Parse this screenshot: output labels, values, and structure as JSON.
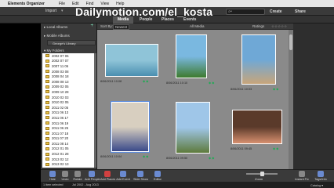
{
  "menubar": {
    "app": "Elements Organizer",
    "items": [
      "File",
      "Edit",
      "Find",
      "View",
      "Help"
    ]
  },
  "topbar": {
    "import": "Import",
    "create": "Create",
    "share": "Share"
  },
  "watermark": "Dailymotion.com/el_kosta",
  "tabs": [
    {
      "label": "Media",
      "active": true
    },
    {
      "label": "People",
      "active": false
    },
    {
      "label": "Places",
      "active": false
    },
    {
      "label": "Events",
      "active": false
    }
  ],
  "sidebar": {
    "local_albums": "Local Albums",
    "mobile_albums": "Mobile Albums",
    "library": "George's Library",
    "my_folders": "My Folders",
    "folders": [
      "2002 07 06",
      "2002 07 07",
      "2007 11 06",
      "2008 03 08",
      "2008 04 18",
      "2008 08 13",
      "2009 02 05",
      "2009 10 28",
      "2010 02 03",
      "2010 02 05",
      "2011 02 05",
      "2011 06 13",
      "2011 06 17",
      "2011 06 19",
      "2011 06 25",
      "2011 07 18",
      "2011 07 20",
      "2011 08 14",
      "2012 01 05",
      "2012 01 28",
      "2013 02 12",
      "2013 02 13"
    ]
  },
  "filterbar": {
    "sort_by": "Sort By:",
    "sort_value": "Newest",
    "view": "All Media",
    "ratings": "Ratings"
  },
  "photos": [
    {
      "date": "8/06/2011 10:08",
      "colors": [
        "#8fc4d8",
        "#4a8fb0"
      ],
      "selected": false
    },
    {
      "date": "8/06/2011 10:10",
      "colors": [
        "#7ab8e0",
        "#3d7a2e"
      ],
      "selected": false
    },
    {
      "date": "8/06/2011 10:03",
      "colors": [
        "#6fa8d6",
        "#c8a57a"
      ],
      "selected": false
    },
    {
      "date": "8/06/2011 10:04",
      "colors": [
        "#d8cfc0",
        "#3a4a8a"
      ],
      "selected": true
    },
    {
      "date": "8/06/2011 09:50",
      "colors": [
        "#9fc6e8",
        "#5e7a3c"
      ],
      "selected": false
    },
    {
      "date": "8/06/2011 09:45",
      "colors": [
        "#5a3a2a",
        "#d89070"
      ],
      "selected": false
    }
  ],
  "bottombar": {
    "buttons": [
      {
        "label": "Hide",
        "color": "#6a8ad0"
      },
      {
        "label": "Undo",
        "color": "#888"
      },
      {
        "label": "Rotate",
        "color": "#888"
      },
      {
        "label": "Add People",
        "color": "#6a8ad0"
      },
      {
        "label": "Add Places",
        "color": "#d04040"
      },
      {
        "label": "Add Event",
        "color": "#6a8ad0"
      },
      {
        "label": "Slide Show",
        "color": "#6a8ad0"
      },
      {
        "label": "Editor",
        "color": "#6a8ad0"
      }
    ],
    "zoom": "Zoom",
    "right_buttons": [
      {
        "label": "Instant Fix",
        "color": "#888"
      },
      {
        "label": "Tags/Info",
        "color": "#6a8ad0"
      }
    ]
  },
  "statusbar": {
    "left": "1 item selected",
    "mid": "Jul 2002 - Aug 2013",
    "right": "Catalog ▾"
  }
}
